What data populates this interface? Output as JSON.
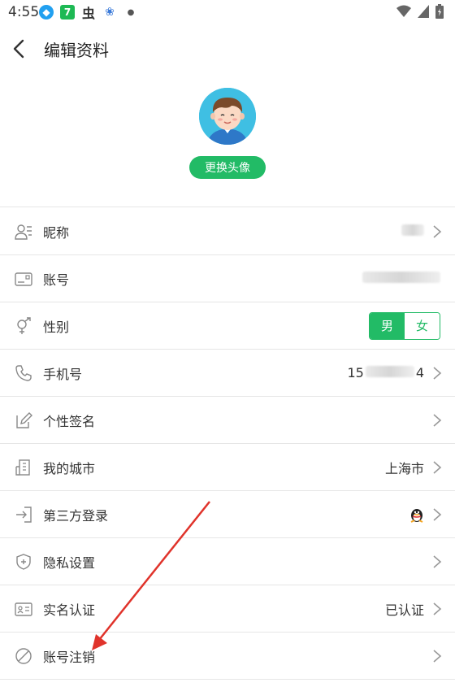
{
  "status_bar": {
    "time": "4:55",
    "icons": [
      "qq-notification-icon",
      "app-7-icon",
      "chinese-char-icon",
      "baidu-paw-icon",
      "dot-icon"
    ],
    "right_icons": [
      "wifi-icon",
      "signal-icon",
      "battery-icon"
    ]
  },
  "header": {
    "title": "编辑资料"
  },
  "avatar": {
    "change_label": "更换头像"
  },
  "rows": [
    {
      "key": "nickname",
      "label": "昵称",
      "value": "",
      "icon": "user-card-icon"
    },
    {
      "key": "account",
      "label": "账号",
      "value": "",
      "icon": "id-card-icon"
    },
    {
      "key": "gender",
      "label": "性别",
      "icon": "gender-icon",
      "options": [
        "男",
        "女"
      ],
      "selected": "男"
    },
    {
      "key": "phone",
      "label": "手机号",
      "value_prefix": "15",
      "value_suffix": "4",
      "icon": "phone-icon"
    },
    {
      "key": "signature",
      "label": "个性签名",
      "value": "",
      "icon": "edit-icon"
    },
    {
      "key": "city",
      "label": "我的城市",
      "value": "上海市",
      "icon": "building-icon"
    },
    {
      "key": "third_party",
      "label": "第三方登录",
      "value": "",
      "icon": "login-icon",
      "badge_icon": "qq-penguin-icon"
    },
    {
      "key": "privacy",
      "label": "隐私设置",
      "value": "",
      "icon": "shield-icon"
    },
    {
      "key": "realname",
      "label": "实名认证",
      "value": "已认证",
      "icon": "id-verify-icon"
    },
    {
      "key": "cancel",
      "label": "账号注销",
      "value": "",
      "icon": "ban-icon"
    }
  ],
  "colors": {
    "accent": "#22bb66",
    "annotation_arrow": "#e0332b"
  }
}
